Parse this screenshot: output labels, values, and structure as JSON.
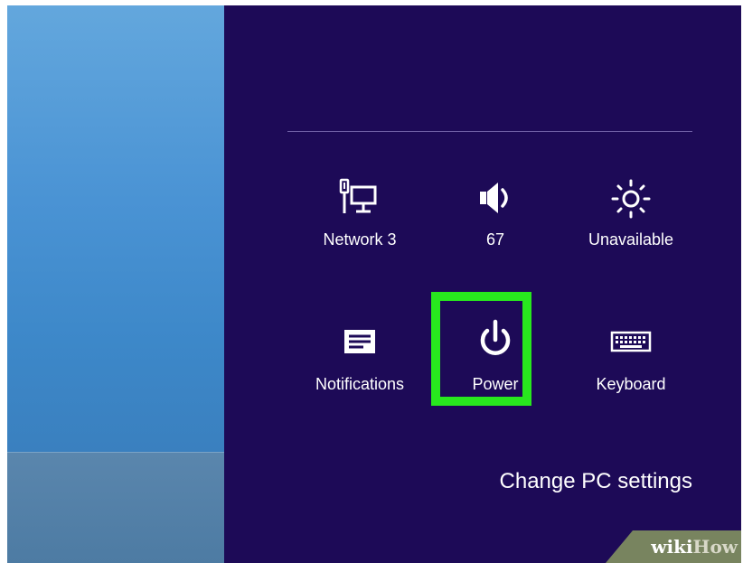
{
  "settings": {
    "tiles": [
      {
        "label": "Network  3",
        "icon": "network-icon"
      },
      {
        "label": "67",
        "icon": "volume-icon"
      },
      {
        "label": "Unavailable",
        "icon": "brightness-icon"
      },
      {
        "label": "Notifications",
        "icon": "notifications-icon"
      },
      {
        "label": "Power",
        "icon": "power-icon"
      },
      {
        "label": "Keyboard",
        "icon": "keyboard-icon"
      }
    ],
    "change_pc_settings": "Change PC settings"
  },
  "watermark": {
    "part1": "wiki",
    "part2": "How"
  },
  "colors": {
    "charm_background": "#1d0a57",
    "highlight": "#28e81e",
    "desktop": "#4a93d4"
  }
}
